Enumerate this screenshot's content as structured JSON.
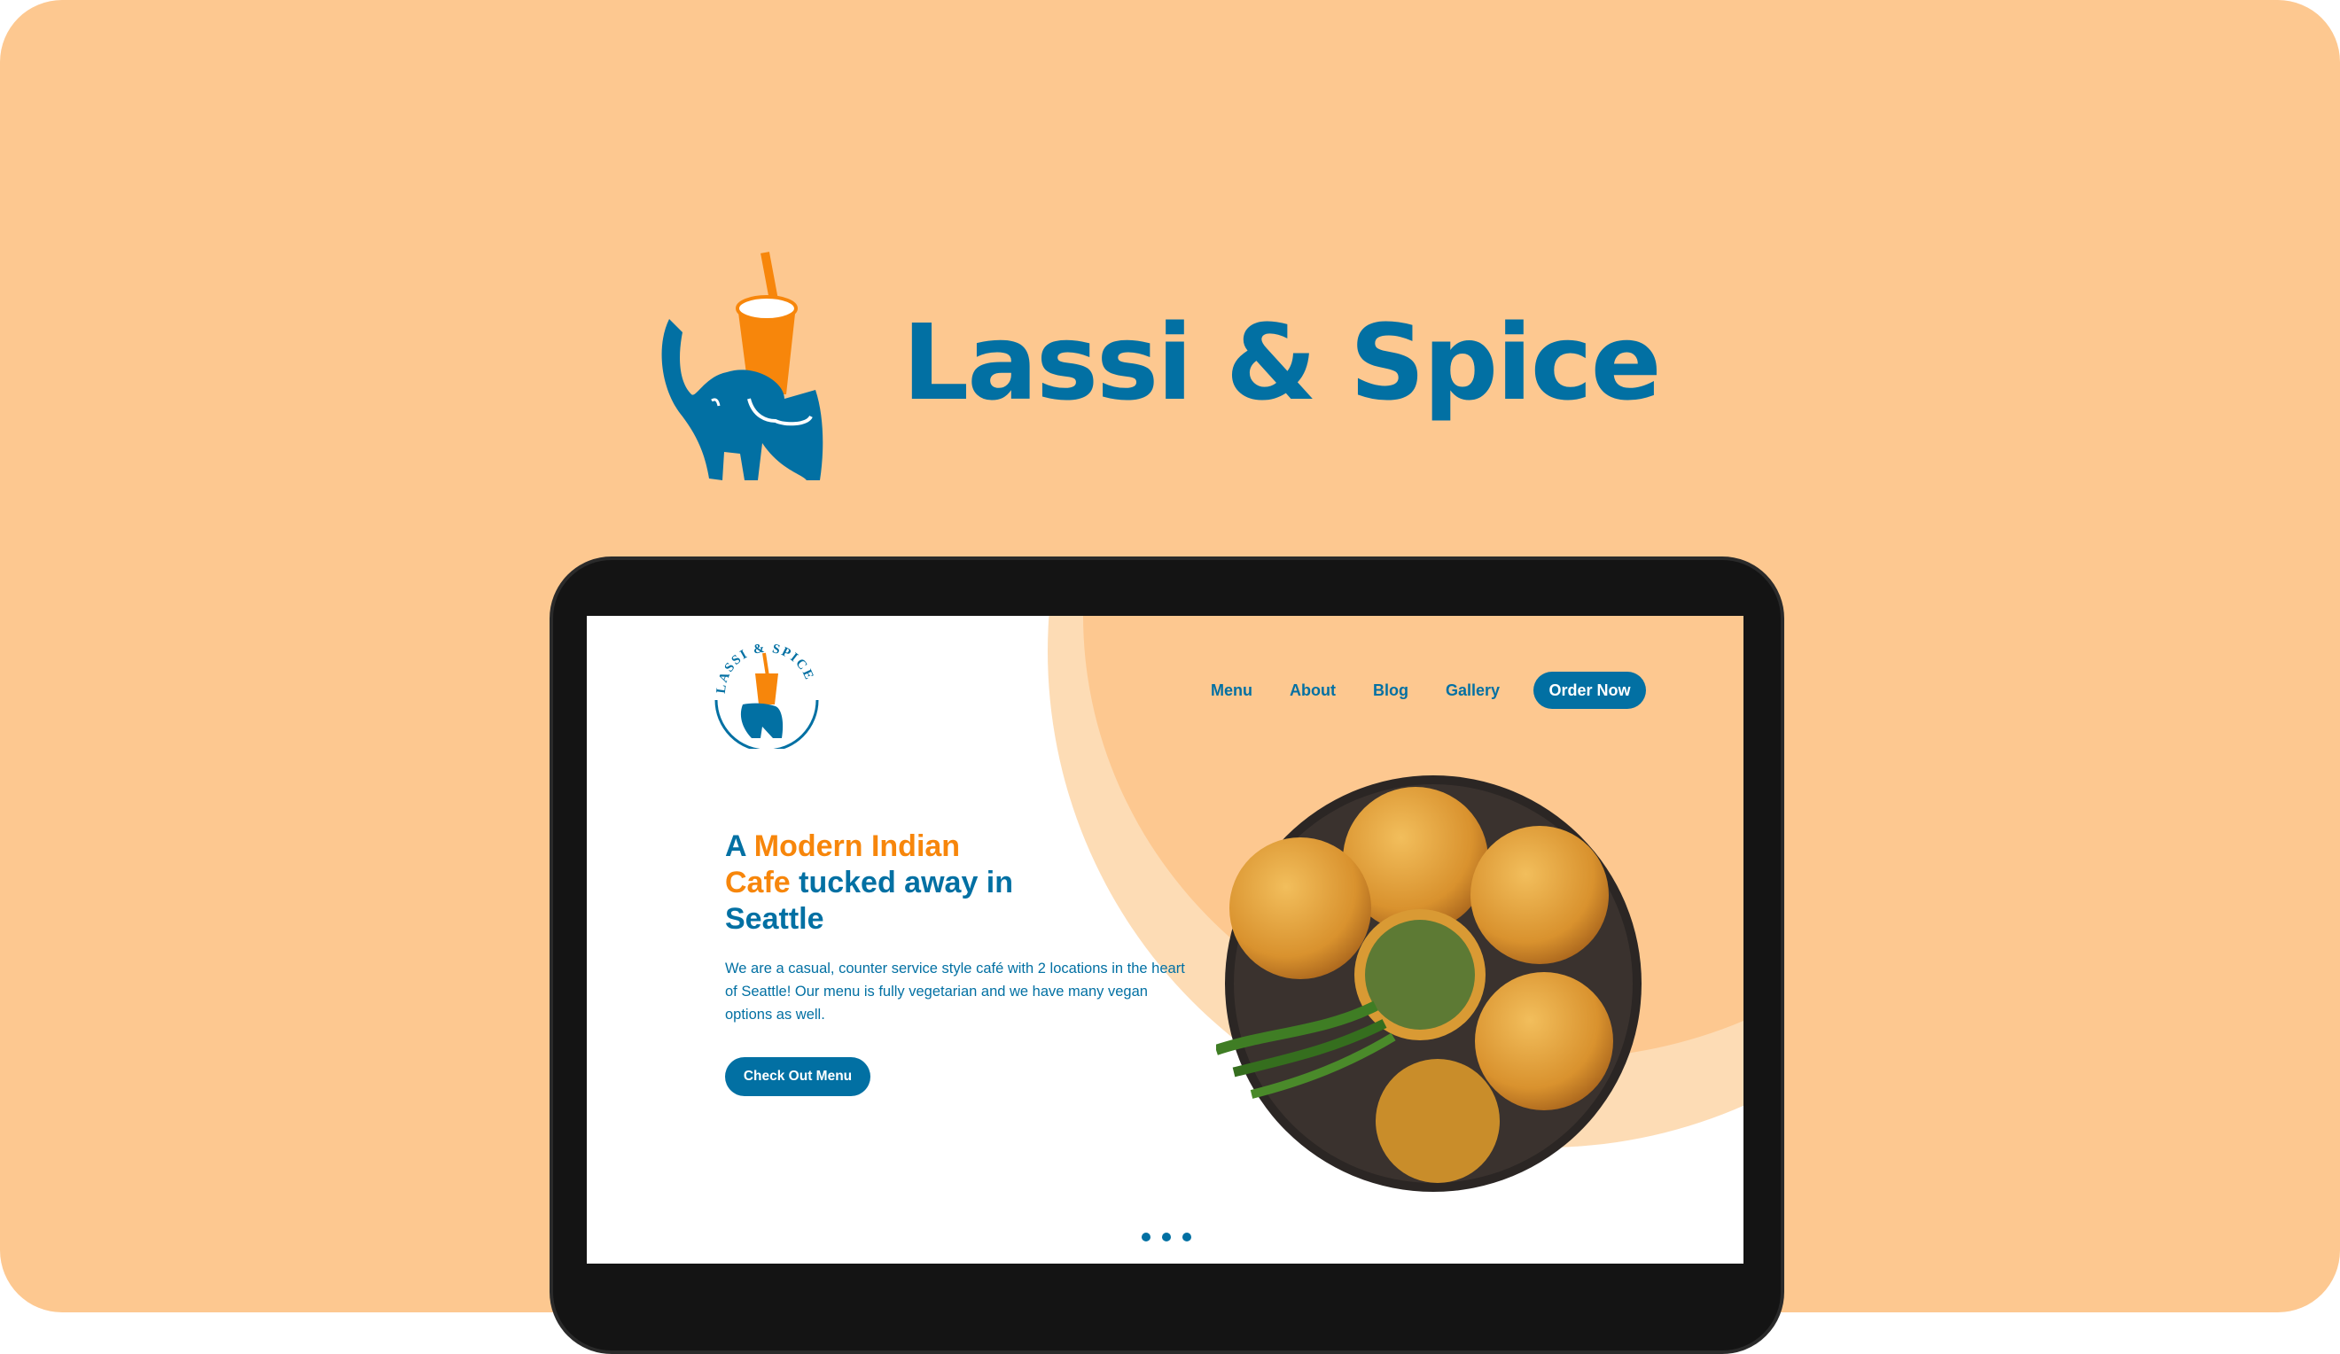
{
  "brand": {
    "name": "Lassi & Spice",
    "logo_text": "LASSI & SPICE"
  },
  "colors": {
    "blue": "#0270a3",
    "orange": "#f7860b",
    "peach": "#fdc890"
  },
  "nav": {
    "items": [
      "Menu",
      "About",
      "Blog",
      "Gallery"
    ],
    "cta": "Order Now"
  },
  "hero": {
    "headline_a": "A ",
    "headline_b": "Modern Indian",
    "headline_c": "Cafe",
    "headline_d": " tucked away in Seattle",
    "description": "We are a casual, counter service style café with 2 locations in the heart of Seattle! Our menu is fully vegetarian and we have many vegan options as well.",
    "cta": "Check Out Menu"
  },
  "carousel": {
    "count": 3
  }
}
